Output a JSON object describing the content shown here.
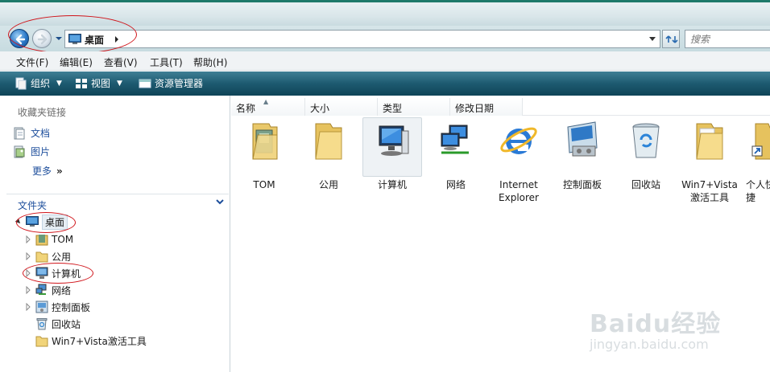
{
  "address": {
    "location": "桌面",
    "search_placeholder": "搜索"
  },
  "menu": [
    "文件(F)",
    "编辑(E)",
    "查看(V)",
    "工具(T)",
    "帮助(H)"
  ],
  "commandbar": {
    "organize": "组织",
    "views": "视图",
    "explorer": "资源管理器"
  },
  "navpane": {
    "favorites_header": "收藏夹链接",
    "favorites": [
      "文档",
      "图片"
    ],
    "more": "更多",
    "folders_header": "文件夹",
    "tree": [
      {
        "label": "桌面",
        "level": 0,
        "selected": true
      },
      {
        "label": "TOM",
        "level": 1
      },
      {
        "label": "公用",
        "level": 1
      },
      {
        "label": "计算机",
        "level": 1
      },
      {
        "label": "网络",
        "level": 1
      },
      {
        "label": "控制面板",
        "level": 1
      },
      {
        "label": "回收站",
        "level": 1
      },
      {
        "label": "Win7+Vista激活工具",
        "level": 1
      }
    ]
  },
  "columns": [
    "名称",
    "大小",
    "类型",
    "修改日期"
  ],
  "items": [
    {
      "name": "TOM",
      "icon": "user-folder-icon"
    },
    {
      "name": "公用",
      "icon": "folder-icon"
    },
    {
      "name": "计算机",
      "icon": "computer-icon",
      "selected": true
    },
    {
      "name": "网络",
      "icon": "network-icon"
    },
    {
      "name": "Internet Explorer",
      "icon": "ie-icon"
    },
    {
      "name": "控制面板",
      "icon": "control-panel-icon"
    },
    {
      "name": "回收站",
      "icon": "recycle-bin-icon"
    },
    {
      "name": "Win7+Vista激活工具",
      "icon": "folder-icon"
    },
    {
      "name": "个人快捷",
      "icon": "shortcut-folder-icon"
    }
  ],
  "watermark": {
    "brand": "Baidu经验",
    "url": "jingyan.baidu.com"
  }
}
